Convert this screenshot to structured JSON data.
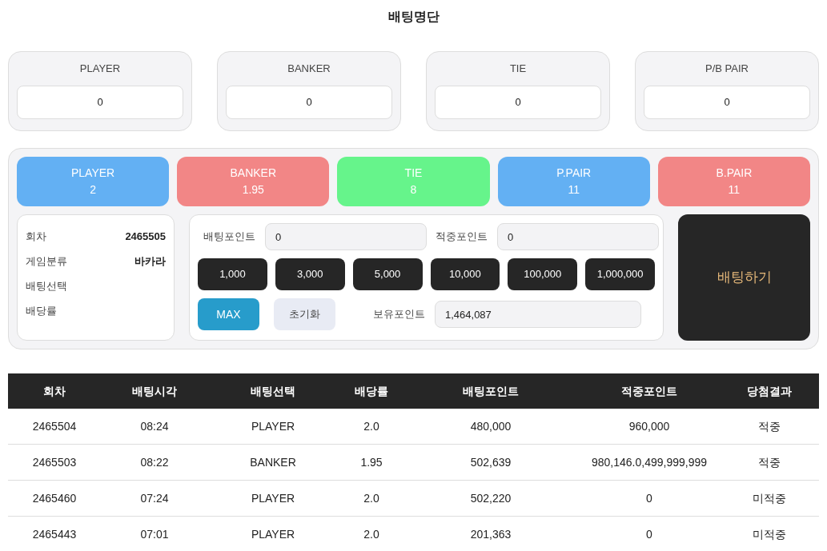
{
  "title": "배팅명단",
  "summary": [
    {
      "label": "PLAYER",
      "value": "0"
    },
    {
      "label": "BANKER",
      "value": "0"
    },
    {
      "label": "TIE",
      "value": "0"
    },
    {
      "label": "P/B PAIR",
      "value": "0"
    }
  ],
  "bet_options": [
    {
      "label": "PLAYER",
      "odds": "2",
      "color": "#63b0f3"
    },
    {
      "label": "BANKER",
      "odds": "1.95",
      "color": "#f28686"
    },
    {
      "label": "TIE",
      "odds": "8",
      "color": "#66f48b"
    },
    {
      "label": "P.PAIR",
      "odds": "11",
      "color": "#63b0f3"
    },
    {
      "label": "B.PAIR",
      "odds": "11",
      "color": "#f28686"
    }
  ],
  "info": [
    {
      "label": "회차",
      "value": "2465505"
    },
    {
      "label": "게임분류",
      "value": "바카라"
    },
    {
      "label": "배팅선택"
    },
    {
      "label": "배당률"
    }
  ],
  "bet_point": {
    "label": "배팅포인트",
    "value": "0"
  },
  "win_point": {
    "label": "적중포인트",
    "value": "0"
  },
  "chips": [
    "1,000",
    "3,000",
    "5,000",
    "10,000",
    "100,000",
    "1,000,000"
  ],
  "max_button": "MAX",
  "reset_button": "초기화",
  "held_point": {
    "label": "보유포인트",
    "value": "1,464,087"
  },
  "bet_button": "배팅하기",
  "table": {
    "columns": [
      "회차",
      "배팅시각",
      "배팅선택",
      "배당률",
      "배팅포인트",
      "적중포인트",
      "당첨결과"
    ],
    "rows": [
      [
        "2465504",
        "08:24",
        "PLAYER",
        "2.0",
        "480,000",
        "960,000",
        "적중"
      ],
      [
        "2465503",
        "08:22",
        "BANKER",
        "1.95",
        "502,639",
        "980,146.0,499,999,999",
        "적중"
      ],
      [
        "2465460",
        "07:24",
        "PLAYER",
        "2.0",
        "502,220",
        "0",
        "미적중"
      ],
      [
        "2465443",
        "07:01",
        "PLAYER",
        "2.0",
        "201,363",
        "0",
        "미적중"
      ]
    ]
  }
}
